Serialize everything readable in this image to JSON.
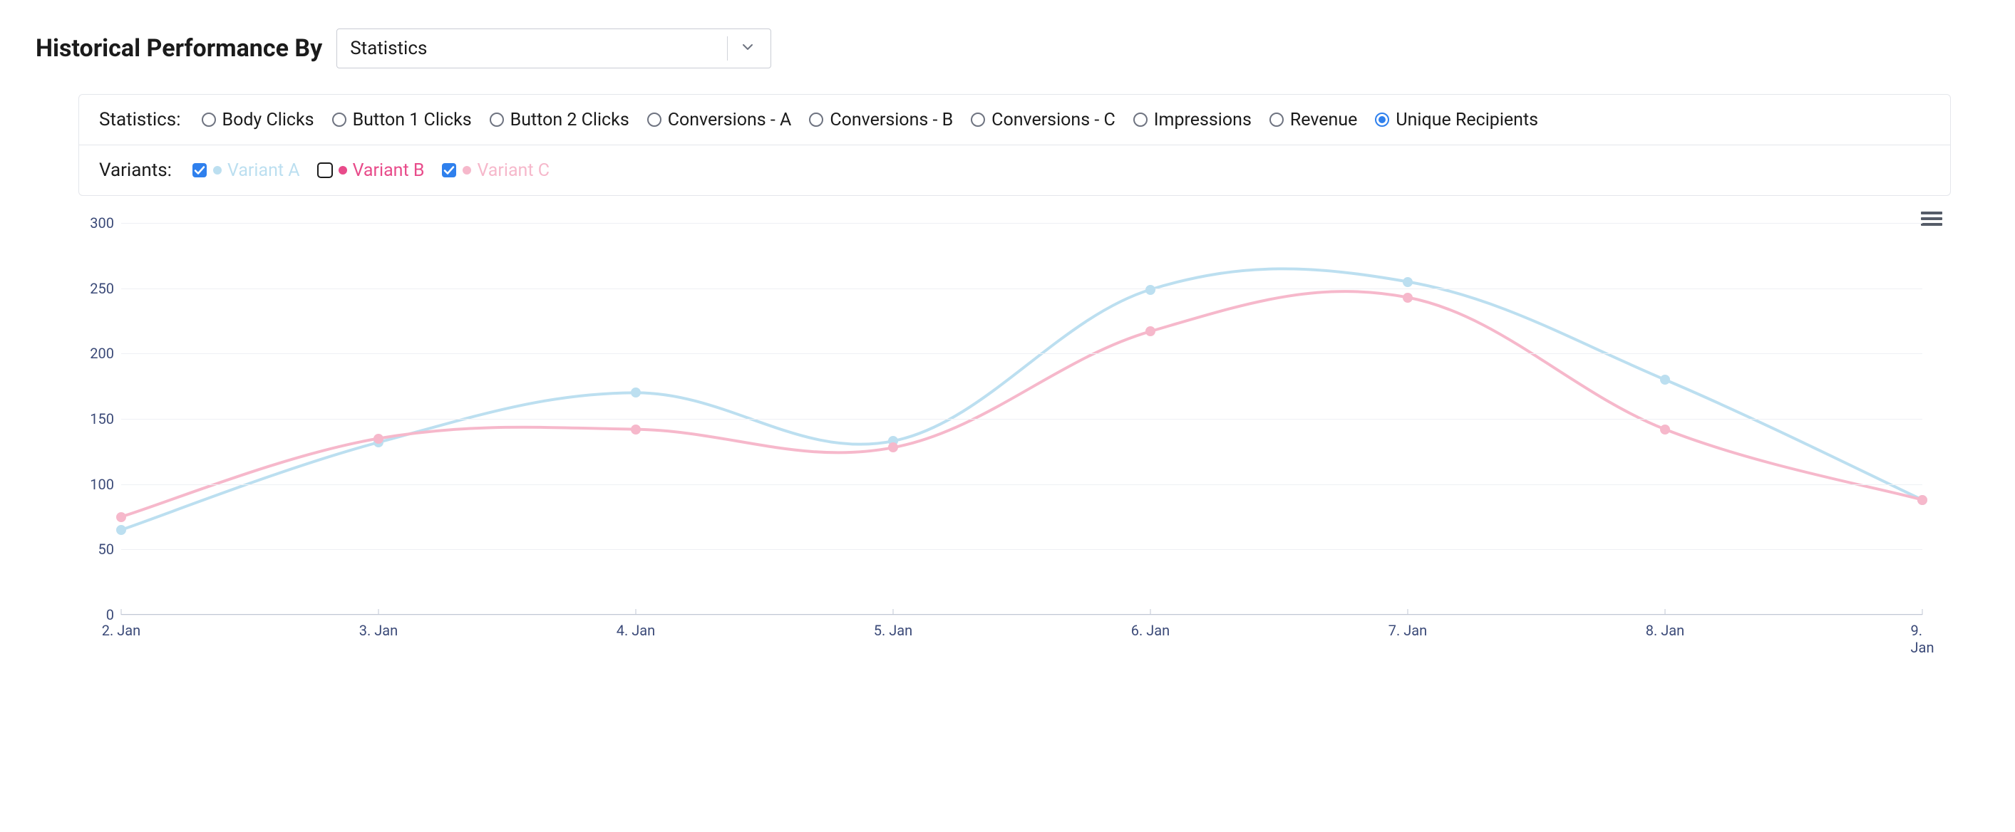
{
  "header": {
    "title": "Historical Performance By",
    "dropdown_value": "Statistics"
  },
  "filters": {
    "stats_label": "Statistics:",
    "statistics": [
      {
        "label": "Body Clicks",
        "selected": false
      },
      {
        "label": "Button 1 Clicks",
        "selected": false
      },
      {
        "label": "Button 2 Clicks",
        "selected": false
      },
      {
        "label": "Conversions - A",
        "selected": false
      },
      {
        "label": "Conversions - B",
        "selected": false
      },
      {
        "label": "Conversions - C",
        "selected": false
      },
      {
        "label": "Impressions",
        "selected": false
      },
      {
        "label": "Revenue",
        "selected": false
      },
      {
        "label": "Unique Recipients",
        "selected": true
      }
    ],
    "variants_label": "Variants:",
    "variants": [
      {
        "label": "Variant A",
        "checked": true,
        "color": "#bcdff0",
        "text_color": "#bcdff0"
      },
      {
        "label": "Variant B",
        "checked": false,
        "color": "#e84b8a",
        "text_color": "#e84b8a"
      },
      {
        "label": "Variant C",
        "checked": true,
        "color": "#f6b8cb",
        "text_color": "#f6b8cb"
      }
    ]
  },
  "chart_data": {
    "type": "line",
    "title": "",
    "xlabel": "",
    "ylabel": "",
    "ylim": [
      0,
      300
    ],
    "y_ticks": [
      0,
      50,
      100,
      150,
      200,
      250,
      300
    ],
    "categories": [
      "2. Jan",
      "3. Jan",
      "4. Jan",
      "5. Jan",
      "6. Jan",
      "7. Jan",
      "8. Jan",
      "9. Jan"
    ],
    "series": [
      {
        "name": "Variant A",
        "color": "#bcdff0",
        "values": [
          65,
          132,
          170,
          133,
          249,
          255,
          180,
          88
        ]
      },
      {
        "name": "Variant C",
        "color": "#f6b8cb",
        "values": [
          75,
          135,
          142,
          128,
          217,
          243,
          142,
          88
        ]
      }
    ]
  },
  "colors": {
    "accent": "#2f80ed",
    "axis_text": "#3b4a78",
    "grid": "#eef0f4",
    "border": "#e4e6eb"
  }
}
